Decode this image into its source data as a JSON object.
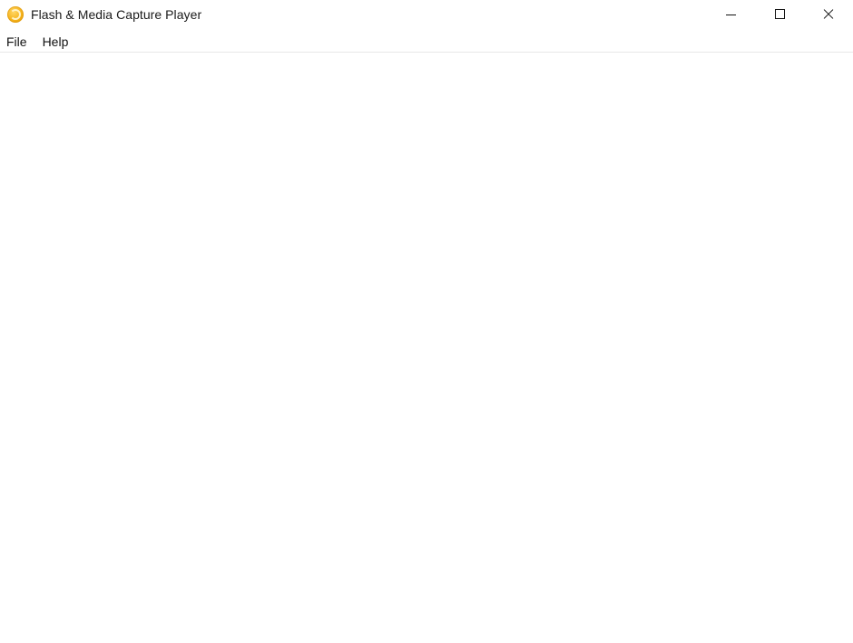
{
  "window": {
    "title": "Flash & Media Capture Player",
    "icon": "app-logo-icon",
    "controls": {
      "minimize": "minimize-icon",
      "maximize": "maximize-icon",
      "close": "close-icon"
    }
  },
  "menubar": {
    "items": [
      {
        "label": "File"
      },
      {
        "label": "Help"
      }
    ]
  },
  "content": {
    "state": "empty"
  }
}
